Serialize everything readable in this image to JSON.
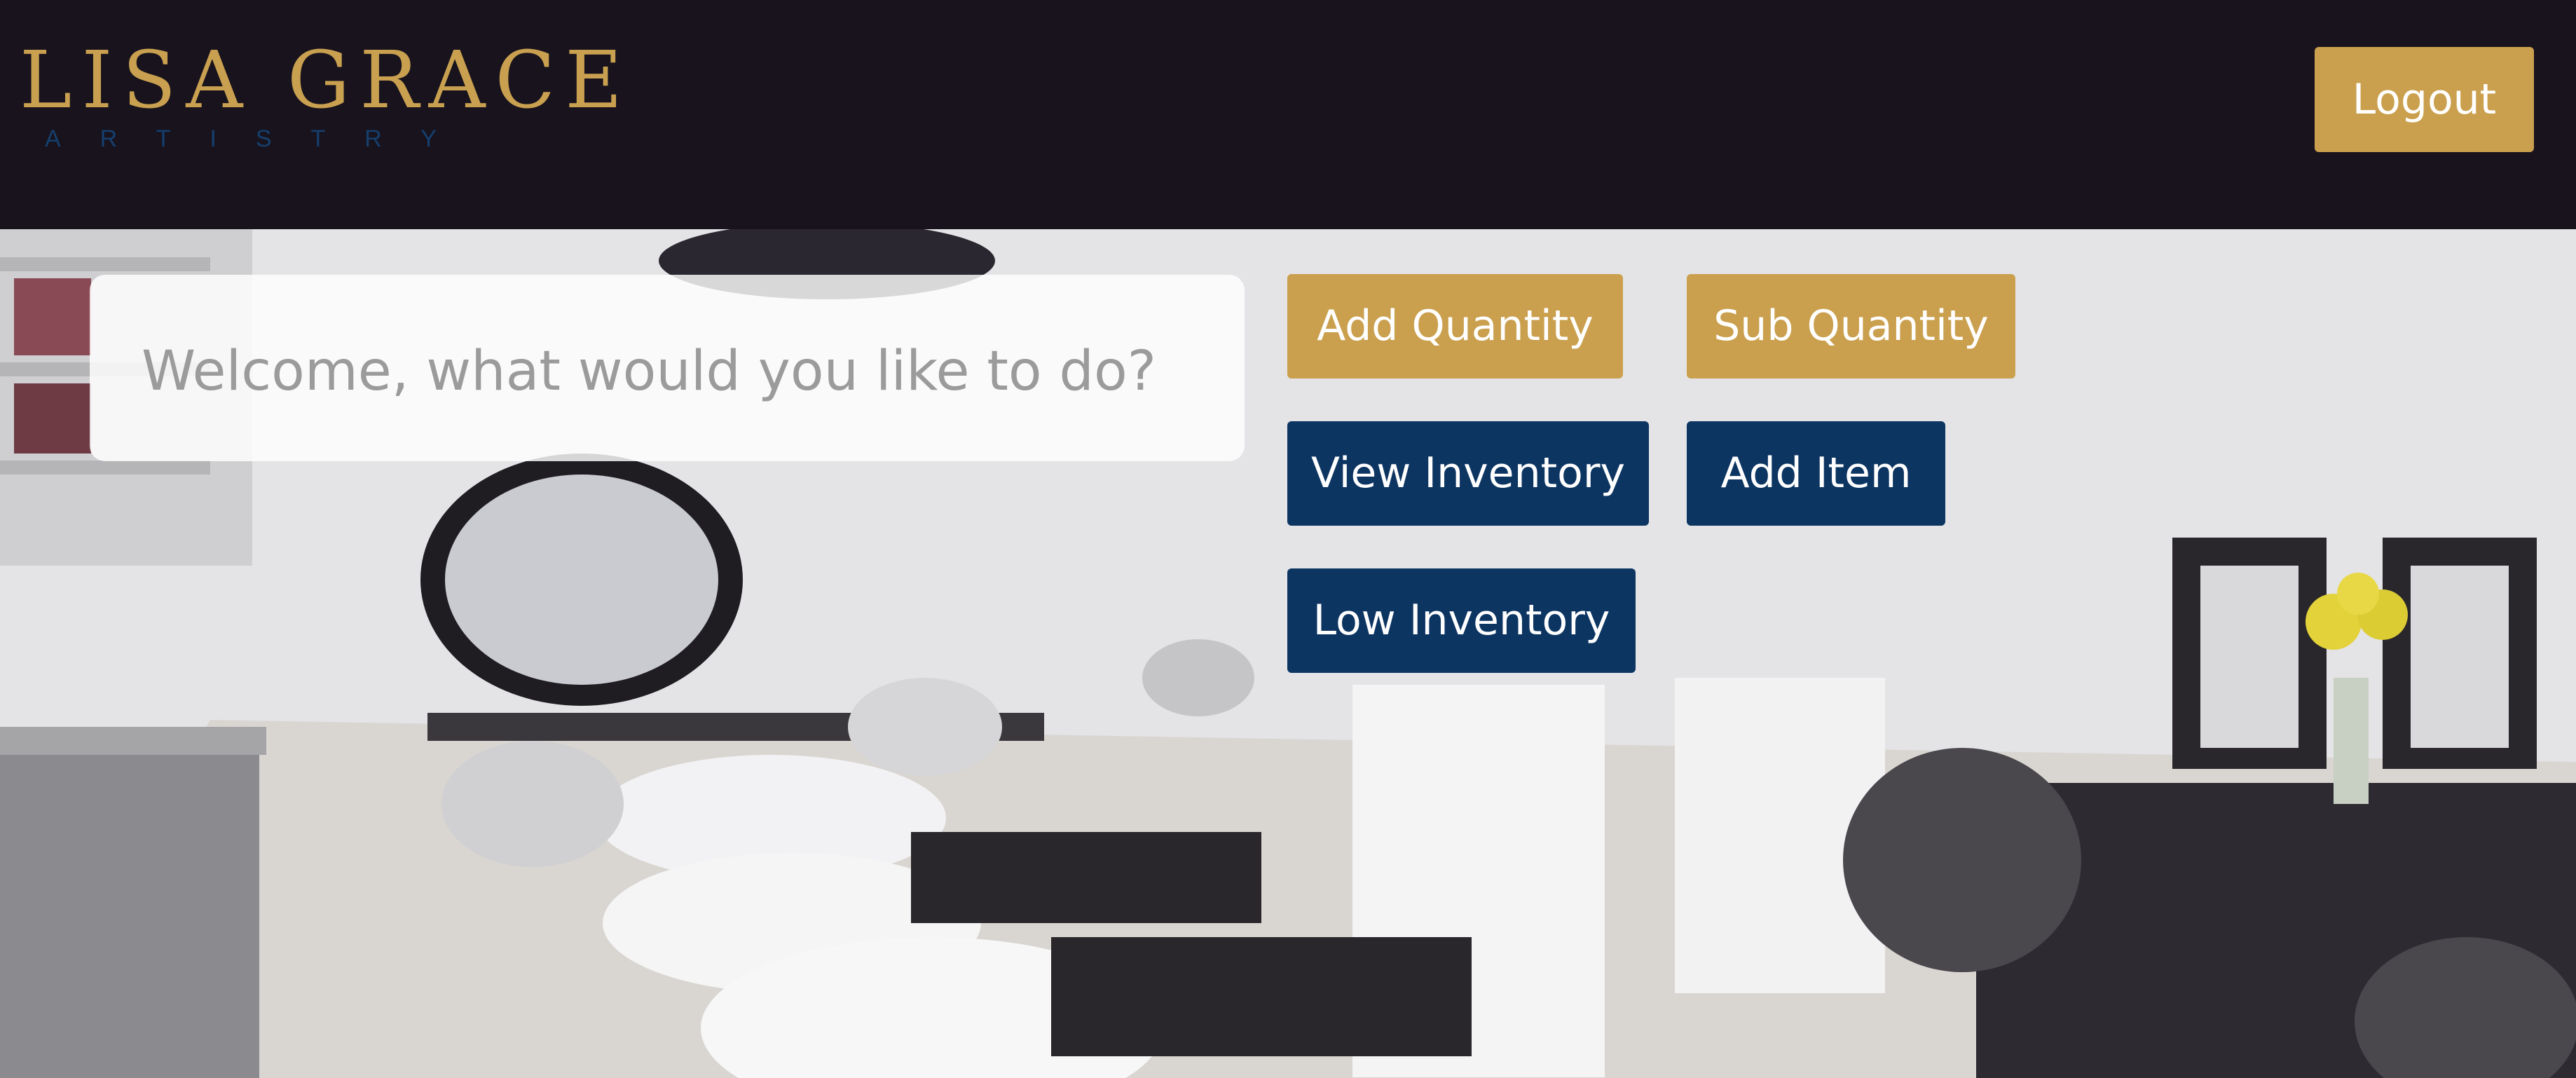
{
  "header": {
    "logo_main": "LISA GRACE",
    "logo_sub": "ARTISTRY",
    "logout_label": "Logout",
    "colors": {
      "background": "#18131d",
      "gold": "#c9a050",
      "navy": "#153f6e"
    }
  },
  "main": {
    "welcome_text": "Welcome, what would you like to do?",
    "actions": {
      "add_quantity": "Add Quantity",
      "sub_quantity": "Sub Quantity",
      "view_inventory": "View Inventory",
      "add_item": "Add Item",
      "low_inventory": "Low Inventory"
    },
    "colors": {
      "primary_button": "#caa04e",
      "secondary_button": "#0d3562"
    }
  }
}
